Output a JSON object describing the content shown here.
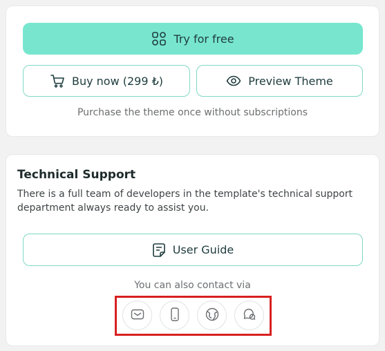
{
  "purchase": {
    "try_label": "Try for free",
    "buy_label": "Buy now (299 ₺)",
    "preview_label": "Preview Theme",
    "note": "Purchase the theme once without subscriptions"
  },
  "support": {
    "title": "Technical Support",
    "description": "There is a full team of developers in the template's technical support department always ready to assist you.",
    "guide_label": "User Guide",
    "contact_label": "You can also contact via",
    "contact_icons": [
      "mail-icon",
      "phone-icon",
      "globe-icon",
      "chat-icon"
    ]
  },
  "colors": {
    "primary_bg": "#78e6cf",
    "outline": "#7fd8c5",
    "highlight": "#d82020"
  }
}
